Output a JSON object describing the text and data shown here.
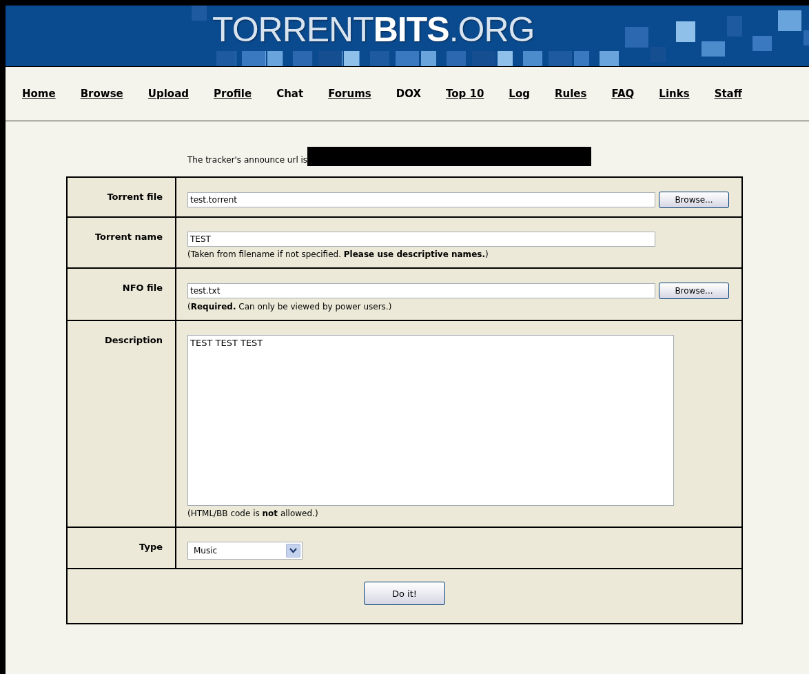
{
  "logo": {
    "text": "TORRENT**BITS**.ORG"
  },
  "nav": [
    {
      "label": "Home",
      "underlined": true
    },
    {
      "label": "Browse",
      "underlined": true
    },
    {
      "label": "Upload",
      "underlined": true
    },
    {
      "label": "Profile",
      "underlined": true
    },
    {
      "label": "Chat",
      "underlined": false
    },
    {
      "label": "Forums",
      "underlined": true
    },
    {
      "label": "DOX",
      "underlined": false
    },
    {
      "label": "Top 10",
      "underlined": true
    },
    {
      "label": "Log",
      "underlined": true
    },
    {
      "label": "Rules",
      "underlined": true
    },
    {
      "label": "FAQ",
      "underlined": true
    },
    {
      "label": "Links",
      "underlined": true
    },
    {
      "label": "Staff",
      "underlined": true
    }
  ],
  "announce": {
    "text": "The tracker's announce url is",
    "redacted": true
  },
  "form": {
    "rows": [
      {
        "kind": "file",
        "label": "Torrent file",
        "value": "test.torrent",
        "button": "Browse..."
      },
      {
        "kind": "text",
        "label": "Torrent name",
        "value": "TEST",
        "hint": "(Taken from filename if not specified. **Please use descriptive names.**)"
      },
      {
        "kind": "file",
        "label": "NFO file",
        "value": "test.txt",
        "button": "Browse...",
        "hint": "(**Required.** Can only be viewed by power users.)"
      },
      {
        "kind": "textarea",
        "label": "Description",
        "value": "TEST TEST TEST",
        "hint": "(HTML/BB code is **not** allowed.)"
      },
      {
        "kind": "select",
        "label": "Type",
        "value": "Music"
      }
    ],
    "submit": "Do it!"
  }
}
